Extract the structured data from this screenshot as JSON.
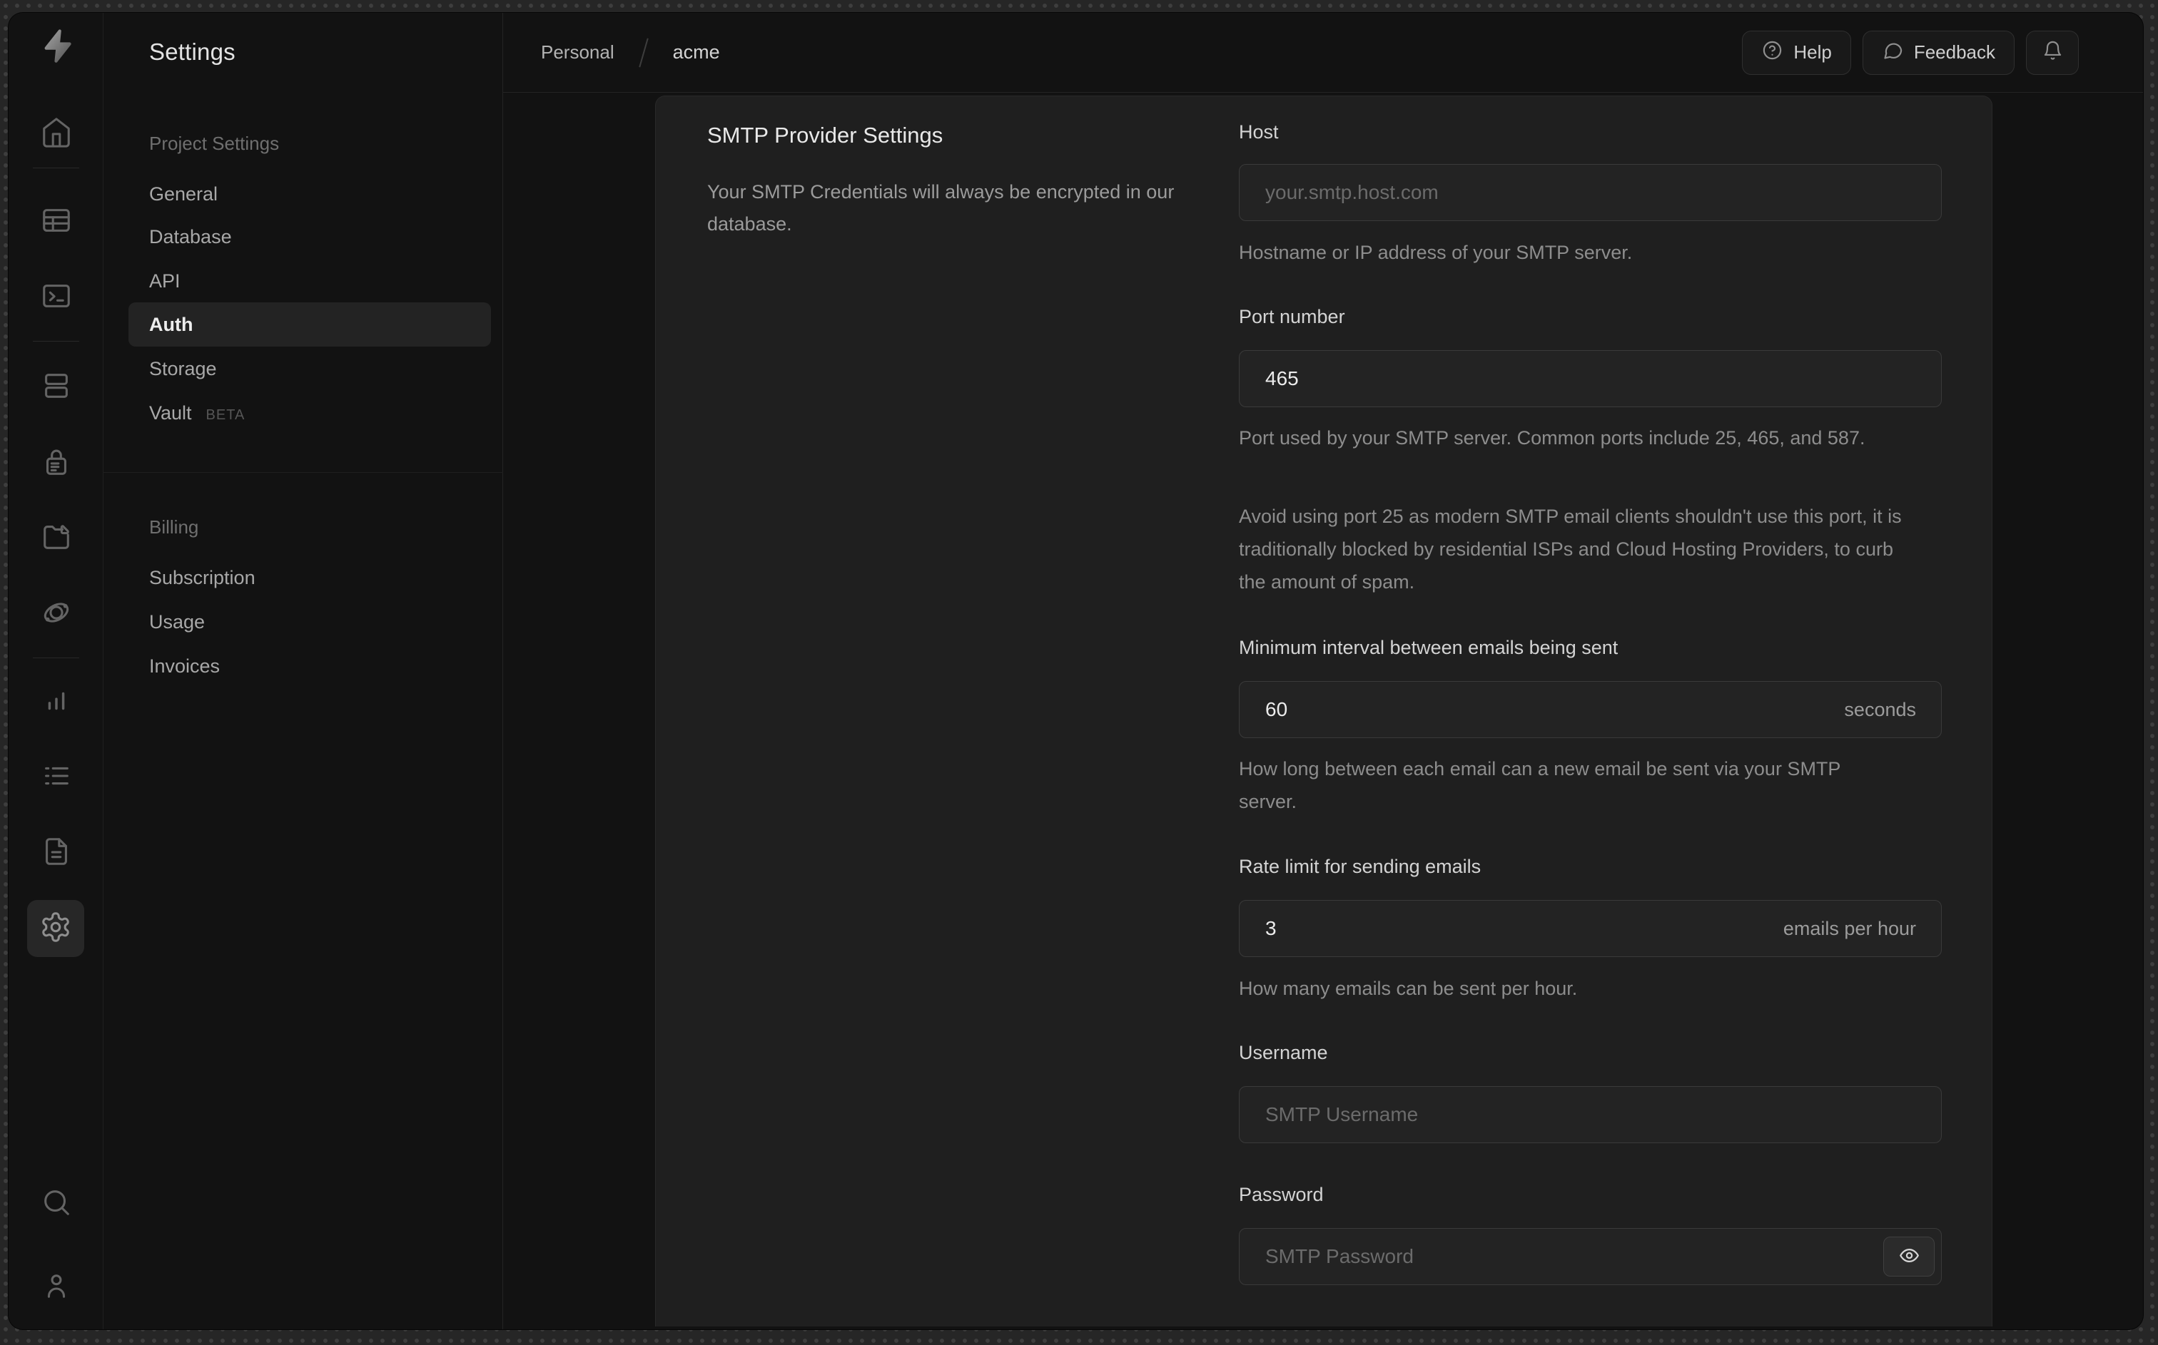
{
  "rail": {
    "icons": [
      "supabase-logo",
      "home",
      "table-editor",
      "sql-editor",
      "database",
      "authentication",
      "storage",
      "edge-functions",
      "reports",
      "logs",
      "api-docs",
      "project-settings",
      "search",
      "account"
    ]
  },
  "sidebar": {
    "title": "Settings",
    "sections": [
      {
        "header": "Project Settings",
        "items": [
          {
            "label": "General"
          },
          {
            "label": "Database"
          },
          {
            "label": "API"
          },
          {
            "label": "Auth",
            "active": true
          },
          {
            "label": "Storage"
          },
          {
            "label": "Vault",
            "badge": "BETA"
          }
        ]
      },
      {
        "header": "Billing",
        "items": [
          {
            "label": "Subscription"
          },
          {
            "label": "Usage"
          },
          {
            "label": "Invoices"
          }
        ]
      }
    ]
  },
  "topbar": {
    "breadcrumb": {
      "org": "Personal",
      "project": "acme"
    },
    "help_label": "Help",
    "feedback_label": "Feedback",
    "icons": [
      "help-circle",
      "feedback-bubble",
      "notifications-bell"
    ]
  },
  "panel": {
    "title": "SMTP Provider Settings",
    "description": "Your SMTP Credentials will always be encrypted in our database.",
    "fields": [
      {
        "label": "Host",
        "placeholder": "your.smtp.host.com",
        "helper": "Hostname or IP address of your SMTP server."
      },
      {
        "label": "Port number",
        "value": "465",
        "helper": "Port used by your SMTP server. Common ports include 25, 465, and 587.",
        "helper2": "Avoid using port 25 as modern SMTP email clients shouldn't use this port, it is traditionally blocked by residential ISPs and Cloud Hosting Providers, to curb the amount of spam."
      },
      {
        "label": "Minimum interval between emails being sent",
        "value": "60",
        "suffix": "seconds",
        "helper": "How long between each email can a new email be sent via your SMTP server."
      },
      {
        "label": "Rate limit for sending emails",
        "value": "3",
        "suffix": "emails per hour",
        "helper": "How many emails can be sent per hour."
      },
      {
        "label": "Username",
        "placeholder": "SMTP Username"
      },
      {
        "label": "Password",
        "placeholder": "SMTP Password",
        "eye_icon": "eye"
      }
    ]
  },
  "colors": {
    "frame_bg": "#262626",
    "frame_dot": "#3e3e3e",
    "window_bg": "#121212",
    "panel_bg": "#1f1f1f",
    "input_bg": "#232323",
    "input_border": "#3a3a3a",
    "border": "#232323",
    "text_primary": "#ededed",
    "text_secondary": "#9b9b9b",
    "text_muted": "#6b6b6b",
    "active_pill_bg": "#232323",
    "active_gear_bg": "#272727"
  }
}
